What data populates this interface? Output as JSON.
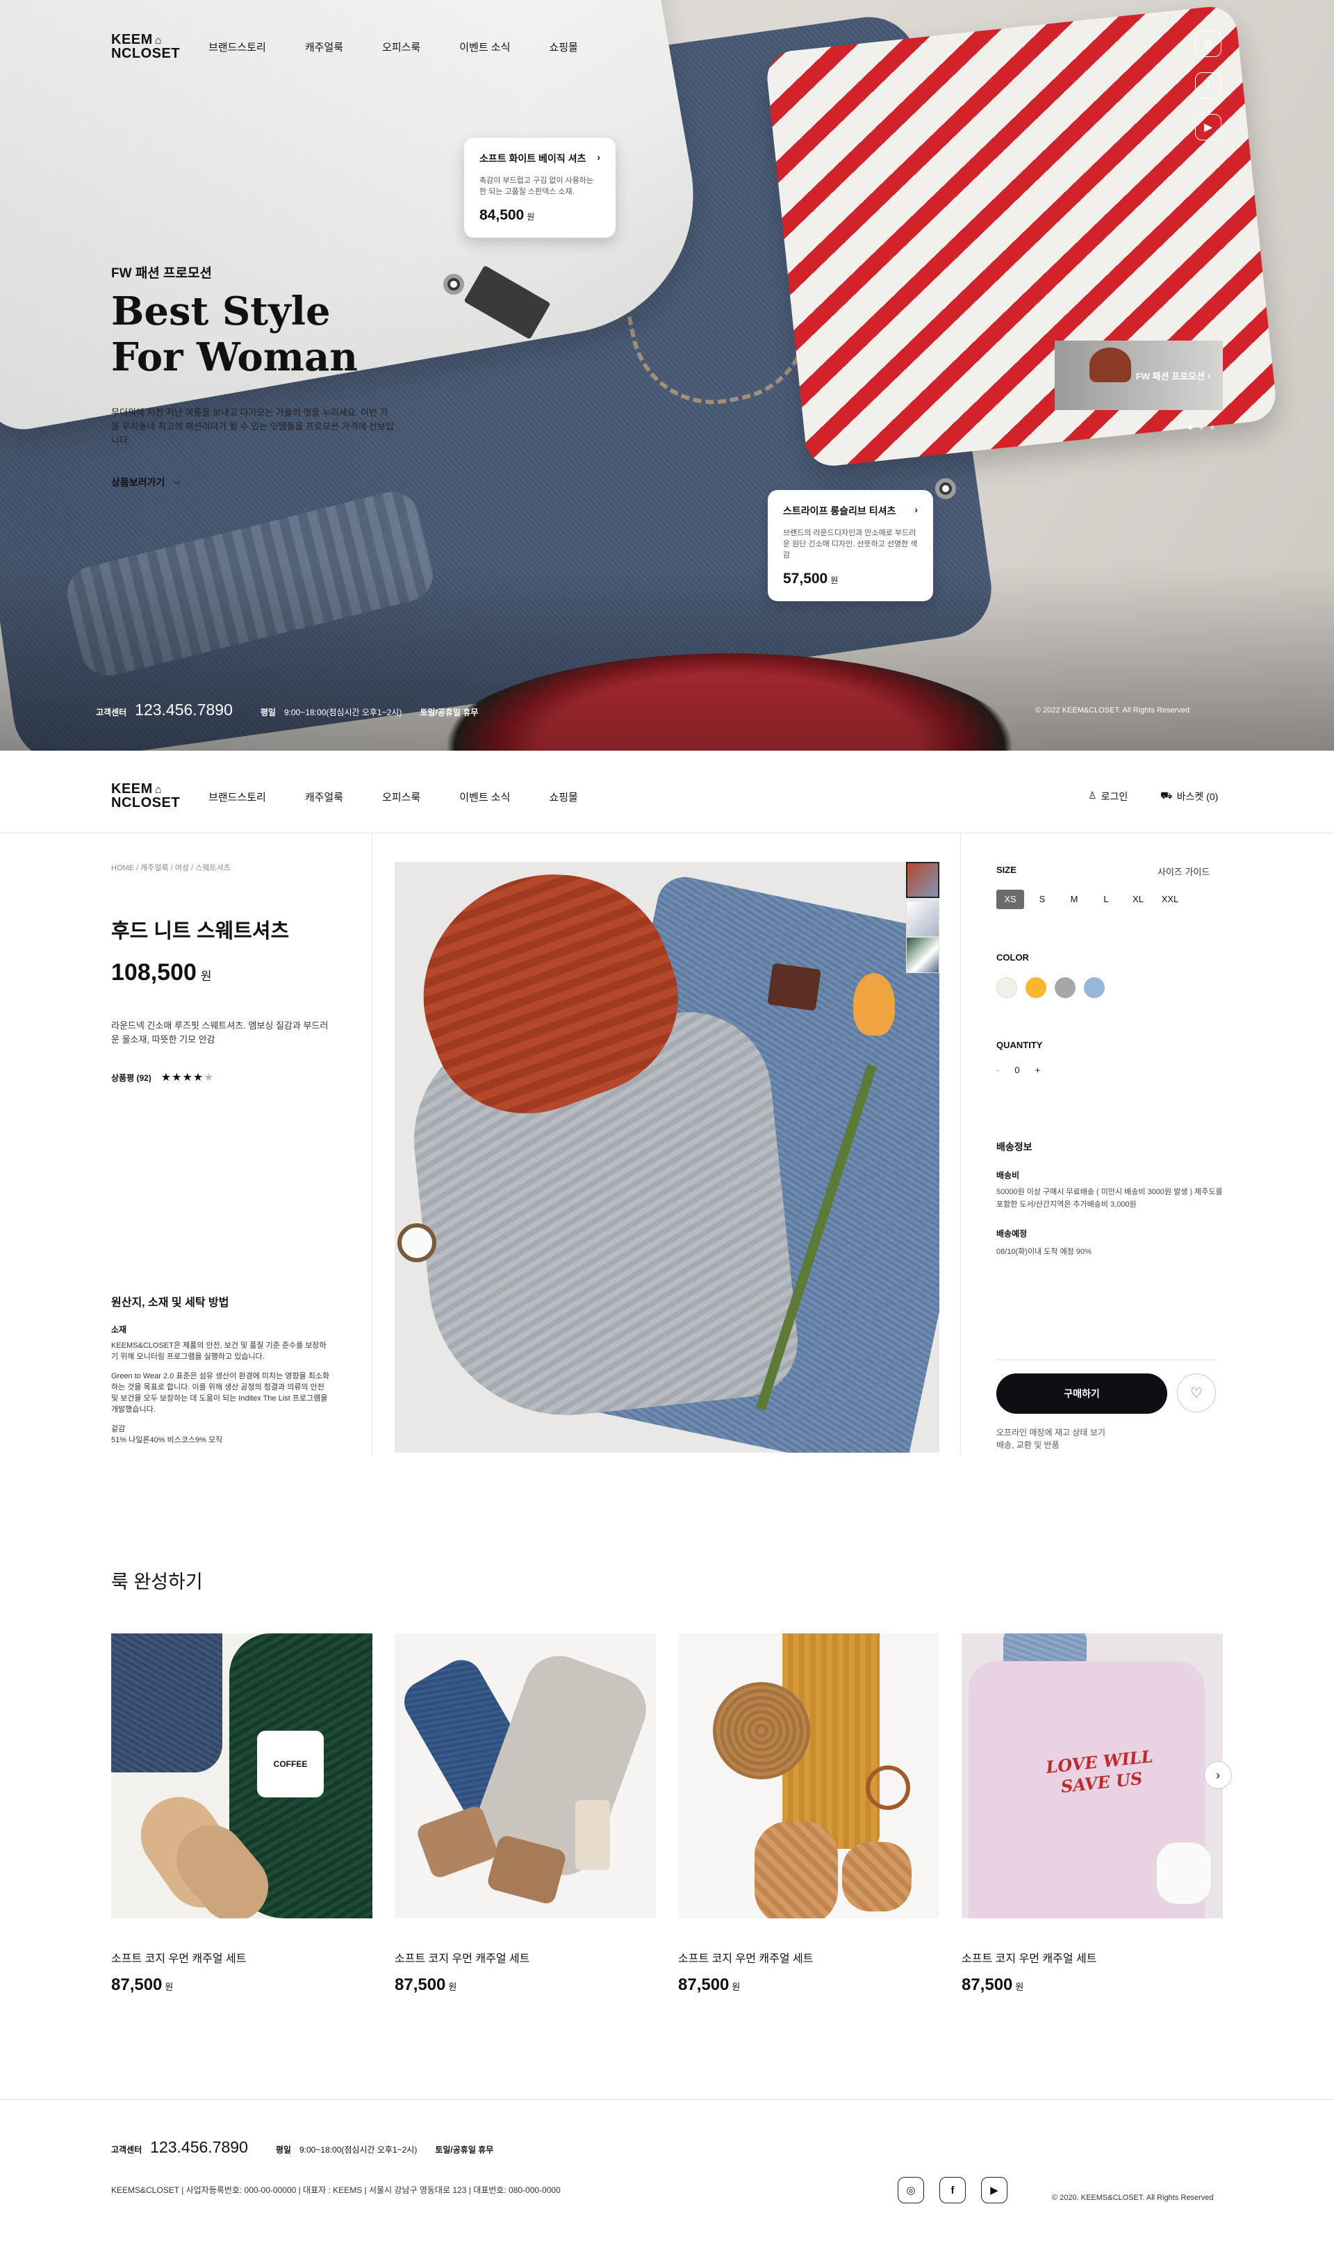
{
  "brand": {
    "line1": "KEEM",
    "line2": "NCLOSET"
  },
  "nav": [
    "브랜드스토리",
    "캐주얼룩",
    "오피스룩",
    "이벤트 소식",
    "쇼핑몰"
  ],
  "hero": {
    "eyebrow": "FW 패션 프로모션",
    "title_line1": "Best Style",
    "title_line2": "For Woman",
    "desc": "무더워에 지친 지난 여름을 보내고 다가오는 가을의 멋을 누리세요. 이번 가을 우리동네 최고의 패션리더가 될 수 있는 잇템들을 프로모션 가격에 선보입니다.",
    "cta": "상품보러가기",
    "card1": {
      "title": "소프트 화이트 베이직 셔츠",
      "desc": "촉감이 부드럽고 구김 없이 사용하는 한 되는 고품질 스판덱스 소재.",
      "price": "84,500",
      "unit": "원"
    },
    "card2": {
      "title": "스트라이프 롱슬리브 티셔츠",
      "desc": "브랜드의 라운드디자인과 만소매로 부드러운 원단 긴소매 디자인. 산뜻하고 선명한 색감",
      "price": "57,500",
      "unit": "원"
    },
    "promo_thumb": "FW 패션 프로모션",
    "slide_dots": 3,
    "footer": {
      "cs_label": "고객센터",
      "phone": "123.456.7890",
      "hours_label": "평일",
      "hours": "9:00~18:00(점심시간 오후1~2시)",
      "closed": "토일/공휴일 휴무",
      "copy": "© 2022 KEEM&CLOSET. All Rights Reserved"
    }
  },
  "header2": {
    "login": "로그인",
    "cart": "바스켓 (0)"
  },
  "product": {
    "breadcrumb": "HOME / 캐주얼룩 / 여성 / 스웨트셔츠",
    "name": "후드 니트 스웨트셔츠",
    "price": "108,500",
    "unit": "원",
    "desc": "라운드넥 긴소매 루즈핏 스웨트셔츠. 엠보싱 질감과 부드러운 울소재, 따뜻한 기모 안감",
    "review_label": "상품평 (92)",
    "rating": 4,
    "rating_max": 5,
    "care_title": "원산지, 소재 및 세탁 방법",
    "care_sub": "소재",
    "care_p1": "KEEMS&CLOSET은 제품의 안전, 보건 및 품질 기준 준수를 보장하기 위해 모니터링 프로그램을 실행하고 있습니다.",
    "care_p2": "Green to Wear 2.0 표준은 섬유 생산이 환경에 미치는 영향을 최소화하는 것을 목표로 합니다. 이를 위해 생산 공정의 청결과 의류의 안전 및 보건을 모두 보장하는 데 도움이 되는 Inditex The List 프로그램을 개발했습니다.",
    "care_p3": "겉감",
    "care_p4": "51% 나일론40% 비스코스9% 모직"
  },
  "options": {
    "size_label": "SIZE",
    "size_guide": "사이즈 가이드",
    "sizes": [
      "XS",
      "S",
      "M",
      "L",
      "XL",
      "XXL"
    ],
    "selected_size": "XS",
    "color_label": "COLOR",
    "colors": [
      "#f3efe6",
      "#f6b72c",
      "#a7a7a7",
      "#98b5da"
    ],
    "qty_label": "QUANTITY",
    "qty_minus": "-",
    "qty": "0",
    "qty_plus": "+",
    "ship_title": "배송정보",
    "ship_fee_label": "배송비",
    "ship_fee": "50000원 이상 구매시 무료배송 ( 미만시 배송비 3000원 발생 ) 제주도를 포함한 도서/산간지역은 추가배송비 3,000원",
    "ship_eta_label": "배송예정",
    "ship_eta": "08/10(화)이내 도착 예정 90%",
    "buy": "구매하기",
    "store_note": "오프라인 매장에 재고 상태 보기",
    "store_note2": "배송, 교환 및 반품"
  },
  "looks": {
    "title": "룩 완성하기",
    "items": [
      {
        "name": "소프트 코지 우먼 캐주얼 세트",
        "price": "87,500",
        "unit": "원"
      },
      {
        "name": "소프트 코지 우먼 캐주얼 세트",
        "price": "87,500",
        "unit": "원"
      },
      {
        "name": "소프트 코지 우먼 캐주얼 세트",
        "price": "87,500",
        "unit": "원"
      },
      {
        "name": "소프트 코지 우먼 캐주얼 세트",
        "price": "87,500",
        "unit": "원"
      }
    ],
    "shirt_text1": "LOVE WILL",
    "shirt_text2": "SAVE US",
    "mug_text": "COFFEE"
  },
  "footer": {
    "cs_label": "고객센터",
    "phone": "123.456.7890",
    "hours_label": "평일",
    "hours": "9:00~18:00(점심시간 오후1~2시)",
    "closed": "토일/공휴일 휴무",
    "company": "KEEMS&CLOSET  |  사업자등록번호: 000-00-00000  |  대표자 : KEEMS | 서울시 강남구 영동대로 123  |  대표번호: 080-000-0000",
    "copy": "© 2020. KEEMS&CLOSET. All Rights Reserved"
  },
  "icons": [
    "instagram-icon",
    "facebook-icon",
    "youtube-icon",
    "user-icon",
    "basket-icon",
    "heart-icon",
    "chevron-right-icon",
    "arrow-right-icon",
    "star-icon"
  ]
}
